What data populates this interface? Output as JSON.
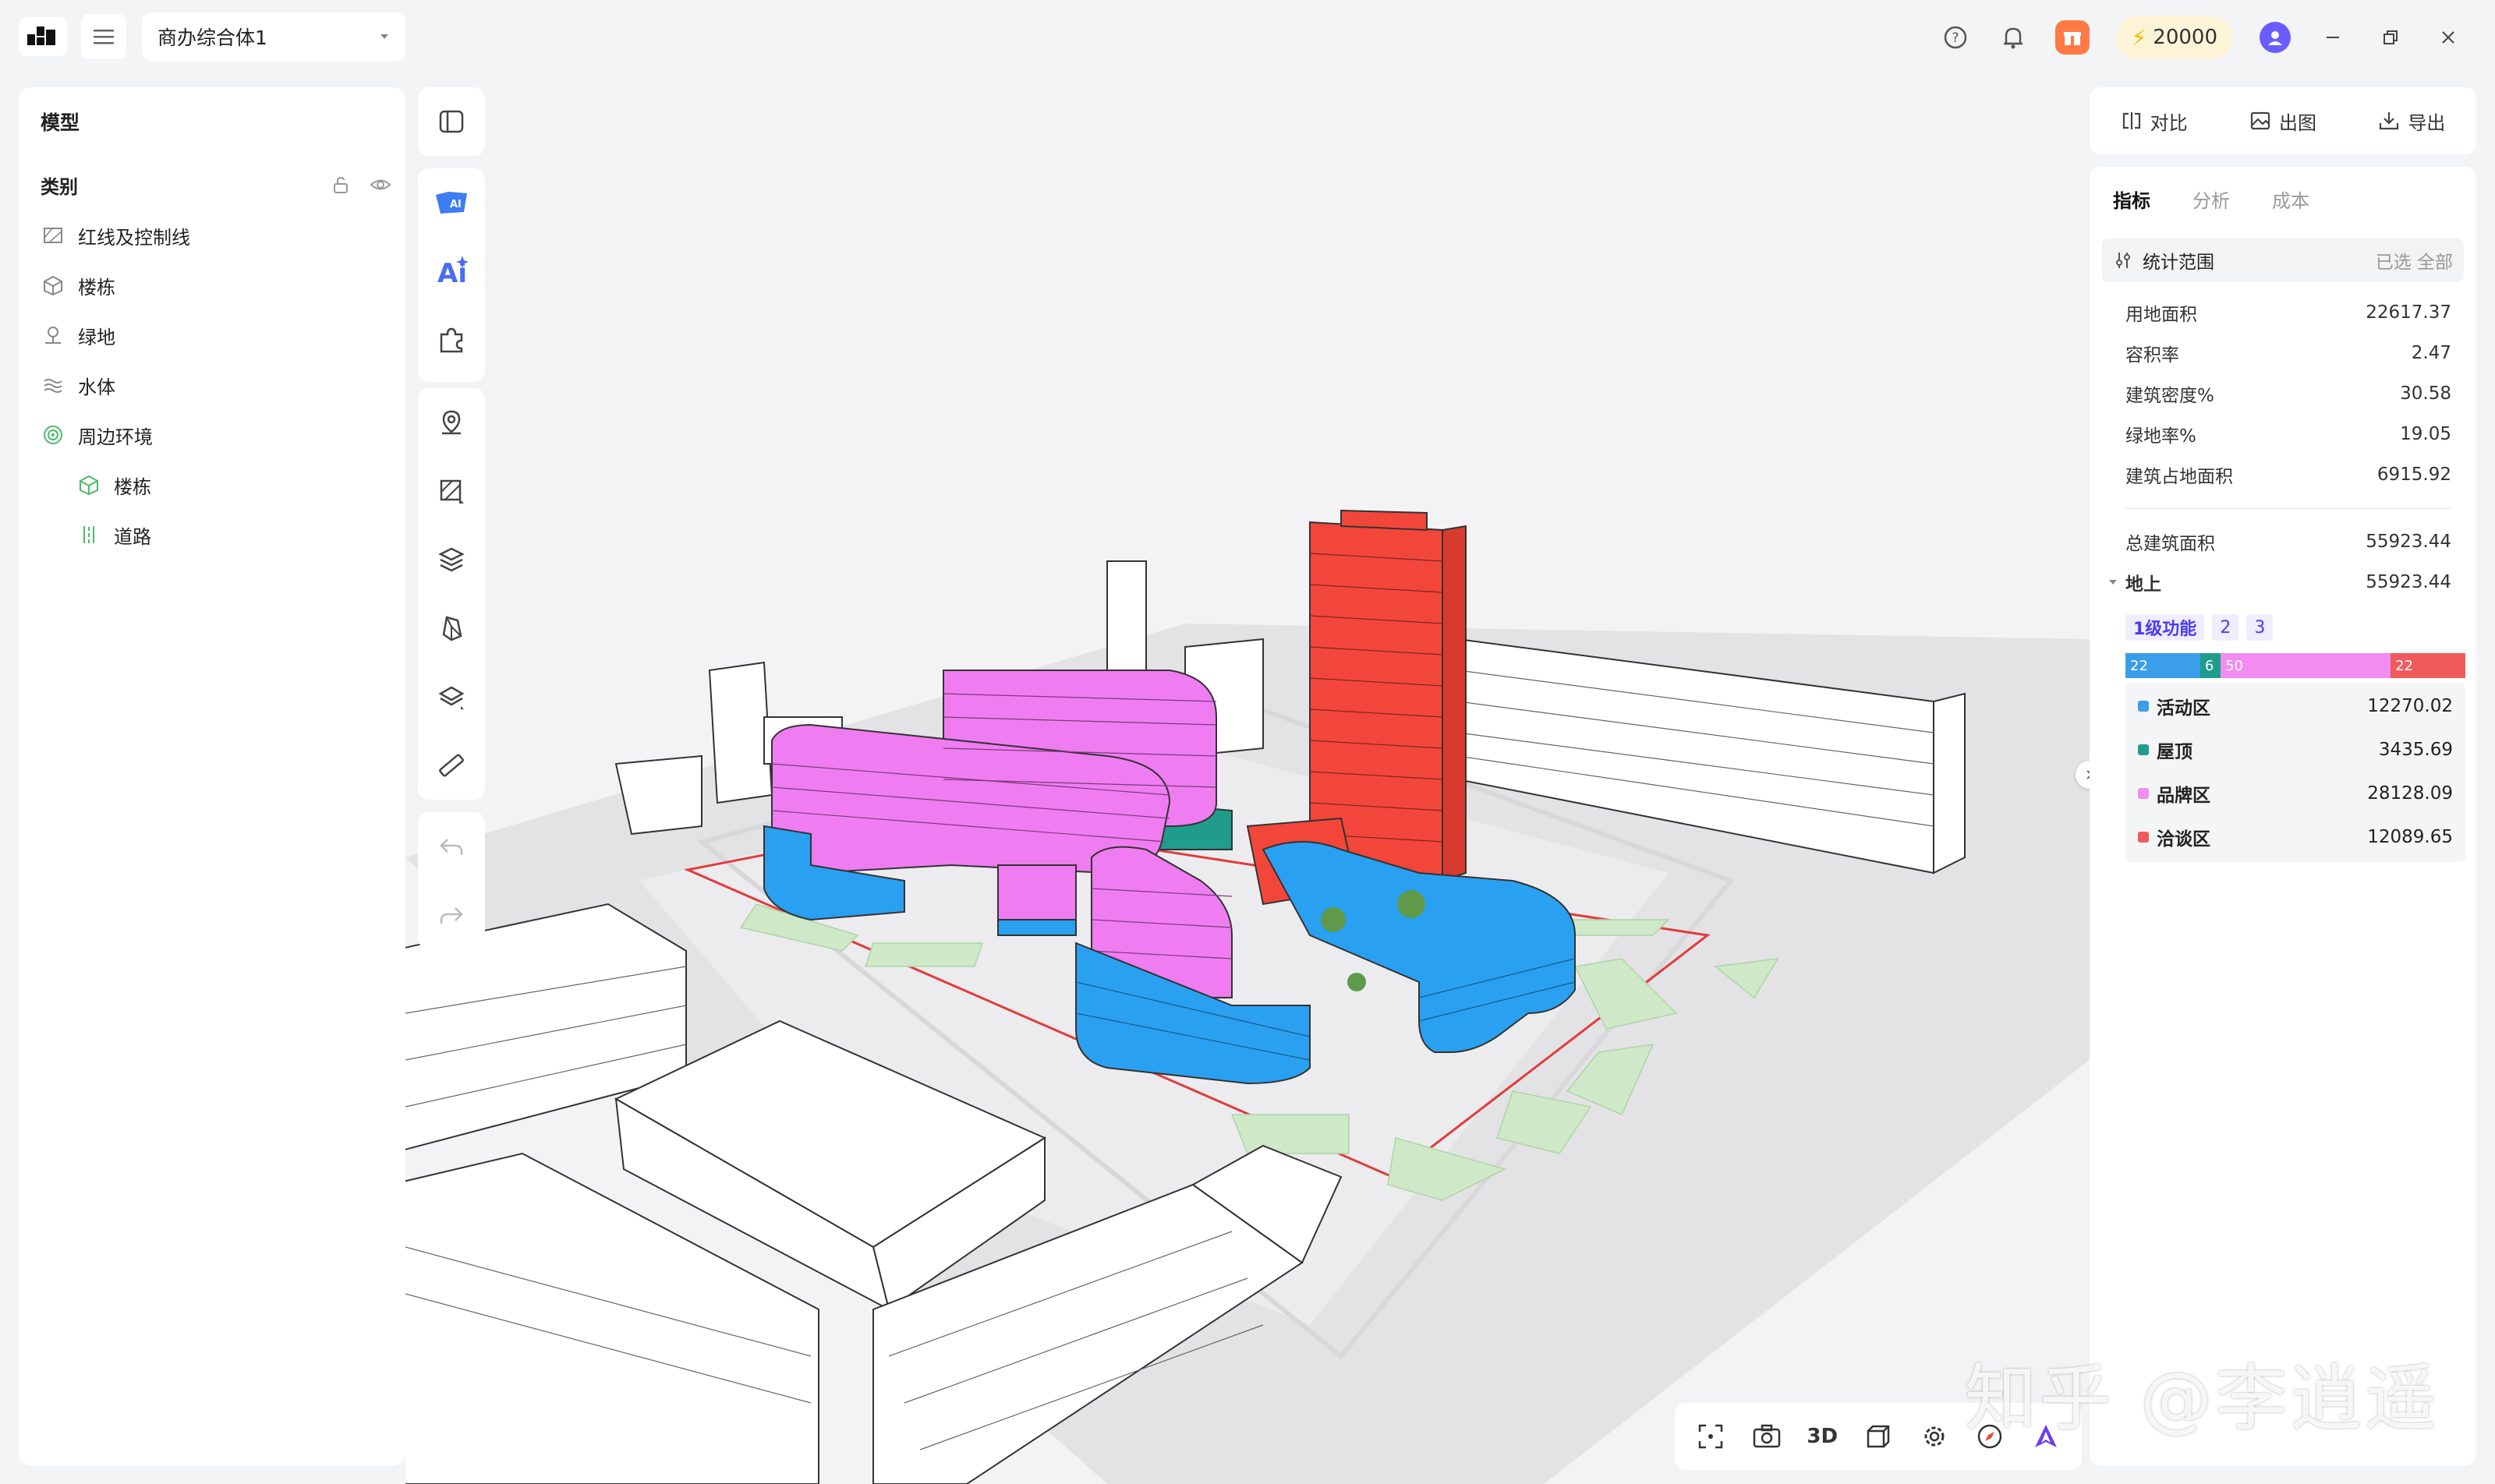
{
  "header": {
    "project_name": "商办综合体1",
    "credits": "20000"
  },
  "left_panel": {
    "title": "模型",
    "category_label": "类别",
    "items": [
      {
        "label": "红线及控制线",
        "icon": "redline-icon"
      },
      {
        "label": "楼栋",
        "icon": "building-cube-icon"
      },
      {
        "label": "绿地",
        "icon": "greenland-icon"
      },
      {
        "label": "水体",
        "icon": "water-icon"
      },
      {
        "label": "周边环境",
        "icon": "surrounding-icon"
      }
    ],
    "children": [
      {
        "label": "楼栋",
        "icon": "building-cube-icon"
      },
      {
        "label": "道路",
        "icon": "road-icon"
      }
    ]
  },
  "toolbar_right": {
    "compare": "对比",
    "render": "出图",
    "export": "导出"
  },
  "right_panel": {
    "tabs": [
      "指标",
      "分析",
      "成本"
    ],
    "scope_label": "统计范围",
    "scope_value": "已选 全部",
    "metrics": [
      {
        "label": "用地面积",
        "value": "22617.37"
      },
      {
        "label": "容积率",
        "value": "2.47"
      },
      {
        "label": "建筑密度%",
        "value": "30.58"
      },
      {
        "label": "绿地率%",
        "value": "19.05"
      },
      {
        "label": "建筑占地面积",
        "value": "6915.92"
      }
    ],
    "total_label": "总建筑面积",
    "total_value": "55923.44",
    "above_label": "地上",
    "above_value": "55923.44",
    "func_tabs": [
      "1级功能",
      "2",
      "3"
    ],
    "stack": [
      {
        "label": "22",
        "pct": 22,
        "color": "#3a9ee8"
      },
      {
        "label": "6",
        "pct": 6,
        "color": "#1f9c8c"
      },
      {
        "label": "50",
        "pct": 50,
        "color": "#f28cf0"
      },
      {
        "label": "22",
        "pct": 22,
        "color": "#ef5b5b"
      }
    ],
    "legend": [
      {
        "label": "活动区",
        "value": "12270.02",
        "color": "#3a9ee8"
      },
      {
        "label": "屋顶",
        "value": "3435.69",
        "color": "#1f9c8c"
      },
      {
        "label": "品牌区",
        "value": "28128.09",
        "color": "#f28cf0"
      },
      {
        "label": "洽谈区",
        "value": "12089.65",
        "color": "#ef5b5b"
      }
    ]
  },
  "bottom_bar": {
    "mode_3d": "3D"
  },
  "watermark": "知乎 @李逍遥",
  "colors": {
    "accent": "#4b3cf0",
    "activity": "#2aa0f0",
    "brand": "#f07cf2",
    "negotiation": "#f2463a",
    "roof": "#1f9c8c",
    "green": "#cfe8c8"
  }
}
